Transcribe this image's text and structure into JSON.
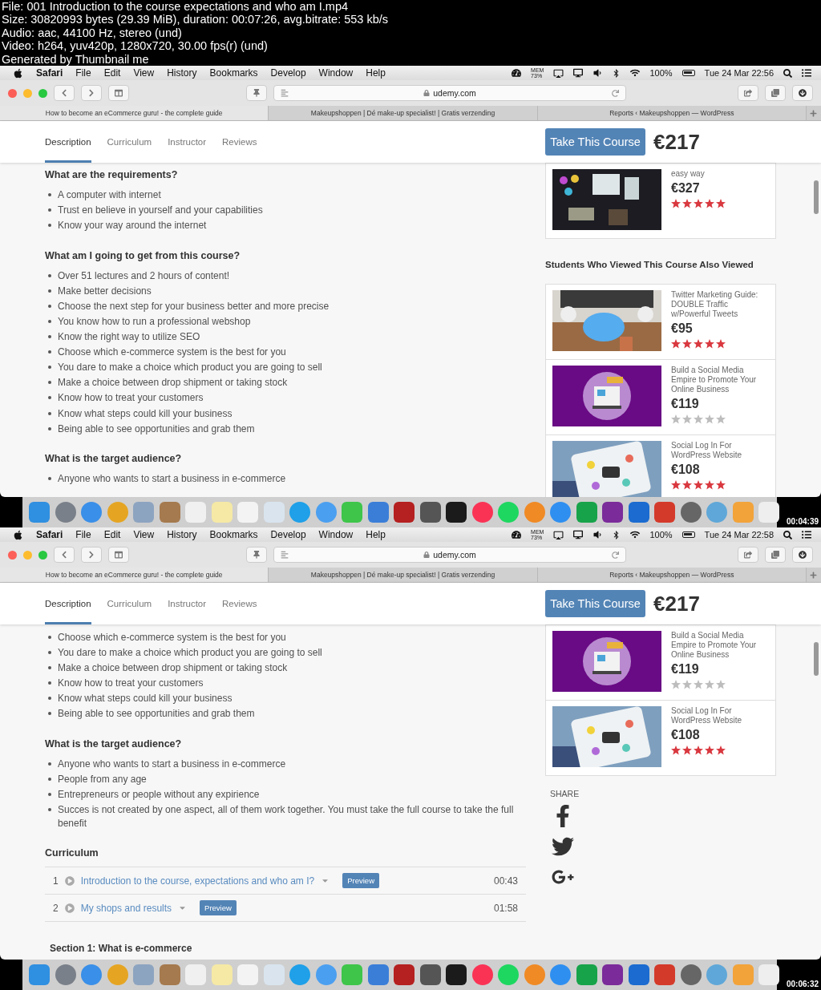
{
  "file_info": [
    "File: 001 Introduction to the course expectations and who am I.mp4",
    "Size: 30820993 bytes (29.39 MiB), duration: 00:07:26, avg.bitrate: 553 kb/s",
    "Audio: aac, 44100 Hz, stereo (und)",
    "Video: h264, yuv420p, 1280x720, 30.00 fps(r) (und)",
    "Generated by Thumbnail me"
  ],
  "frames": [
    {
      "menu_bar": {
        "app": "Safari",
        "items": [
          "File",
          "Edit",
          "View",
          "History",
          "Bookmarks",
          "Develop",
          "Window",
          "Help"
        ],
        "mem_label": "MEM",
        "mem_value": "73%",
        "battery": "100%",
        "clock": "Tue 24 Mar 22:56"
      },
      "address": "udemy.com",
      "browser_tabs": [
        {
          "label": "How to become an eCommerce guru! - the complete guide",
          "selected": true
        },
        {
          "label": "Makeupshoppen | Dé make-up specialist! | Gratis verzending",
          "selected": false
        },
        {
          "label": "Reports ‹ Makeupshoppen — WordPress",
          "selected": false
        }
      ],
      "course_tabs": [
        {
          "label": "Description",
          "selected": true
        },
        {
          "label": "Curriculum",
          "selected": false
        },
        {
          "label": "Instructor",
          "selected": false
        },
        {
          "label": "Reviews",
          "selected": false
        }
      ],
      "cta": "Take This Course",
      "price": "€217",
      "content": [
        {
          "kind": "heading",
          "text": "What are the requirements?"
        },
        {
          "kind": "bullets",
          "items": [
            "A computer with internet",
            "Trust en believe in yourself and your capabilities",
            "Know your way around the internet"
          ]
        },
        {
          "kind": "heading",
          "text": "What am I going to get from this course?"
        },
        {
          "kind": "bullets",
          "items": [
            "Over 51 lectures and 2 hours of content!",
            "Make better decisions",
            "Choose the next step for your business better and more precise",
            "You know how to run a professional webshop",
            "Know the right way to utilize SEO",
            "Choose which e-commerce system is the best for you",
            "You dare to make a choice which product you are going to sell",
            "Make a choice between drop shipment or taking stock",
            "Know how to treat your customers",
            "Know what steps could kill your business",
            "Being able to see opportunities and grab them"
          ]
        },
        {
          "kind": "heading",
          "text": "What is the target audience?"
        },
        {
          "kind": "bullets",
          "items": [
            "Anyone who wants to start a business in e-commerce"
          ]
        }
      ],
      "sidebar": [
        {
          "kind": "cards",
          "cards": [
            {
              "title": "easy way",
              "price": "€327",
              "stars": 5
            }
          ]
        },
        {
          "kind": "heading",
          "text": "Students Who Viewed This Course Also Viewed"
        },
        {
          "kind": "cards",
          "cards": [
            {
              "title": "Twitter Marketing Guide: DOUBLE Traffic w/Powerful Tweets",
              "price": "€95",
              "stars": 5
            },
            {
              "title": "Build a Social Media Empire to Promote Your Online Business",
              "price": "€119",
              "stars": 0
            },
            {
              "title": "Social Log In For WordPress Website",
              "price": "€108",
              "stars": 5
            }
          ]
        }
      ],
      "timestamp": "00:04:39"
    },
    {
      "menu_bar": {
        "app": "Safari",
        "items": [
          "File",
          "Edit",
          "View",
          "History",
          "Bookmarks",
          "Develop",
          "Window",
          "Help"
        ],
        "mem_label": "MEM",
        "mem_value": "73%",
        "battery": "100%",
        "clock": "Tue 24 Mar 22:58"
      },
      "address": "udemy.com",
      "browser_tabs": [
        {
          "label": "How to become an eCommerce guru! - the complete guide",
          "selected": true
        },
        {
          "label": "Makeupshoppen | Dé make-up specialist! | Gratis verzending",
          "selected": false
        },
        {
          "label": "Reports ‹ Makeupshoppen — WordPress",
          "selected": false
        }
      ],
      "course_tabs": [
        {
          "label": "Description",
          "selected": true
        },
        {
          "label": "Curriculum",
          "selected": false
        },
        {
          "label": "Instructor",
          "selected": false
        },
        {
          "label": "Reviews",
          "selected": false
        }
      ],
      "cta": "Take This Course",
      "price": "€217",
      "content": [
        {
          "kind": "bullets",
          "items": [
            "Choose which e-commerce system is the best for you",
            "You dare to make a choice which product you are going to sell",
            "Make a choice between drop shipment or taking stock",
            "Know how to treat your customers",
            "Know what steps could kill your business",
            "Being able to see opportunities and grab them"
          ]
        },
        {
          "kind": "heading",
          "text": "What is the target audience?"
        },
        {
          "kind": "bullets",
          "items": [
            "Anyone who wants to start a business in e-commerce",
            "People from any age",
            "Entrepreneurs or people without any expirience",
            "Succes is not created by one aspect, all of them work together. You must take the full course to take the full benefit"
          ]
        },
        {
          "kind": "heading",
          "text": "Curriculum"
        },
        {
          "kind": "curriculum",
          "rows": [
            {
              "number": "1",
              "title": "Introduction to the course, expectations and who am I?",
              "badge": "Preview",
              "duration": "00:43"
            },
            {
              "number": "2",
              "title": "My shops and results",
              "badge": "Preview",
              "duration": "01:58"
            }
          ]
        },
        {
          "kind": "section",
          "text": "Section 1: What is e-commerce"
        }
      ],
      "sidebar": [
        {
          "kind": "cards",
          "cards": [
            {
              "title": "Build a Social Media Empire to Promote Your Online Business",
              "price": "€119",
              "stars": 0
            },
            {
              "title": "Social Log In For WordPress Website",
              "price": "€108",
              "stars": 5
            }
          ]
        },
        {
          "kind": "share",
          "label": "SHARE",
          "networks": [
            {
              "kind": "facebook"
            },
            {
              "kind": "twitter"
            },
            {
              "kind": "google-plus"
            }
          ]
        }
      ],
      "timestamp": "00:06:32"
    }
  ]
}
